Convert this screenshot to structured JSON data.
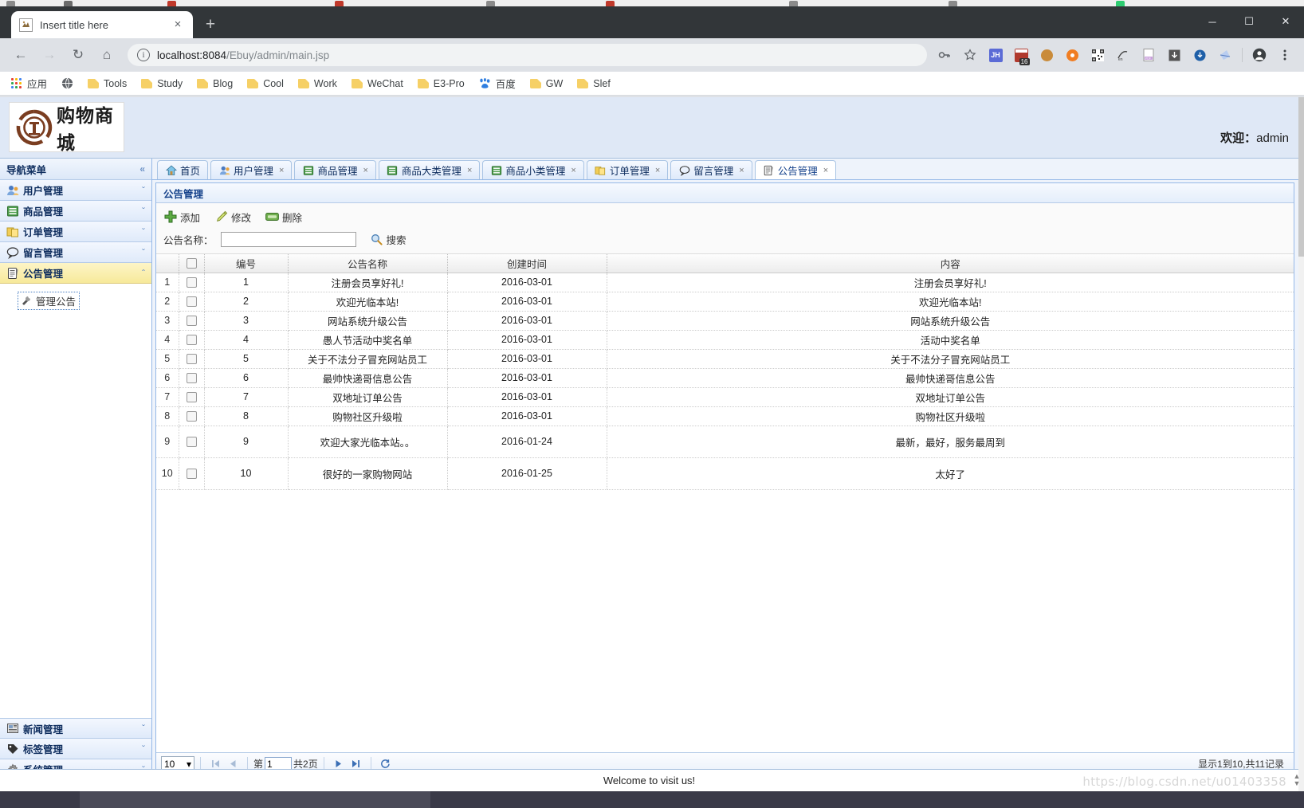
{
  "browser": {
    "tab": {
      "title": "Insert title here",
      "favicon": "page-favicon",
      "close": "×"
    },
    "new_tab": "+",
    "window_controls": {
      "minimize": "─",
      "maximize": "☐",
      "close": "✕"
    },
    "nav": {
      "back": "←",
      "forward": "→",
      "reload": "↻",
      "home": "⌂"
    },
    "omnibox": {
      "info_icon": "i",
      "url_host": "localhost:8084",
      "url_path": "/Ebuy/admin/main.jsp",
      "full_url": "localhost:8084/Ebuy/admin/main.jsp"
    },
    "toolbar_icons": [
      "key-icon",
      "star-icon",
      "jh-extension-icon",
      "calendar-16-icon",
      "monkey-extension-icon",
      "orange-extension-icon",
      "qrcode-extension-icon",
      "translate-extension-icon",
      "pdf-extension-icon",
      "download-extension-icon",
      "circle-download-icon",
      "kite-extension-icon",
      "profile-icon",
      "chrome-menu-icon"
    ],
    "calendar_badge": "16",
    "jh_badge": "JH",
    "bookmarks": {
      "apps_label": "应用",
      "items": [
        {
          "label": "Tools",
          "icon": "folder-icon"
        },
        {
          "label": "Study",
          "icon": "folder-icon"
        },
        {
          "label": "Blog",
          "icon": "folder-icon"
        },
        {
          "label": "Cool",
          "icon": "folder-icon"
        },
        {
          "label": "Work",
          "icon": "folder-icon"
        },
        {
          "label": "WeChat",
          "icon": "folder-icon"
        },
        {
          "label": "E3-Pro",
          "icon": "folder-icon"
        },
        {
          "label": "百度",
          "icon": "baidu-icon"
        },
        {
          "label": "GW",
          "icon": "folder-icon"
        },
        {
          "label": "Slef",
          "icon": "folder-icon"
        }
      ]
    }
  },
  "site": {
    "logo_text": "购物商城",
    "welcome_label": "欢迎：",
    "username": "admin",
    "footer_text": "Welcome to visit us!",
    "watermark": "https://blog.csdn.net/u01403358"
  },
  "sidebar": {
    "title": "导航菜单",
    "collapse_icon": "«",
    "items": [
      {
        "label": "用户管理",
        "icon": "users-icon",
        "expanded": false,
        "chev": "ˇ"
      },
      {
        "label": "商品管理",
        "icon": "goods-icon",
        "expanded": false,
        "chev": "ˇ"
      },
      {
        "label": "订单管理",
        "icon": "order-icon",
        "expanded": false,
        "chev": "ˇ"
      },
      {
        "label": "留言管理",
        "icon": "message-icon",
        "expanded": false,
        "chev": "ˇ"
      },
      {
        "label": "公告管理",
        "icon": "notice-icon",
        "expanded": true,
        "chev": "ˆ"
      }
    ],
    "expanded_children": [
      {
        "label": "管理公告",
        "icon": "tools-icon"
      }
    ],
    "bottom_items": [
      {
        "label": "新闻管理",
        "icon": "news-icon",
        "chev": "ˇ"
      },
      {
        "label": "标签管理",
        "icon": "tag-icon",
        "chev": "ˇ"
      },
      {
        "label": "系统管理",
        "icon": "gear-icon",
        "chev": "ˇ"
      }
    ]
  },
  "tabs": [
    {
      "label": "首页",
      "icon": "home-icon",
      "closable": false,
      "active": false
    },
    {
      "label": "用户管理",
      "icon": "users-icon",
      "closable": true,
      "active": false
    },
    {
      "label": "商品管理",
      "icon": "goods-icon",
      "closable": true,
      "active": false
    },
    {
      "label": "商品大类管理",
      "icon": "goods-icon",
      "closable": true,
      "active": false
    },
    {
      "label": "商品小类管理",
      "icon": "goods-icon",
      "closable": true,
      "active": false
    },
    {
      "label": "订单管理",
      "icon": "order-icon",
      "closable": true,
      "active": false
    },
    {
      "label": "留言管理",
      "icon": "message-icon",
      "closable": true,
      "active": false
    },
    {
      "label": "公告管理",
      "icon": "notice-icon",
      "closable": true,
      "active": true
    }
  ],
  "tab_close_glyph": "×",
  "panel": {
    "title": "公告管理",
    "toolbar": [
      {
        "label": "添加",
        "icon": "add-icon"
      },
      {
        "label": "修改",
        "icon": "edit-icon"
      },
      {
        "label": "删除",
        "icon": "delete-icon"
      }
    ],
    "search": {
      "label": "公告名称：",
      "value": "",
      "placeholder": "",
      "button_label": "搜索",
      "button_icon": "search-icon"
    }
  },
  "table": {
    "columns": [
      "",
      "",
      "编号",
      "公告名称",
      "创建时间",
      "内容"
    ],
    "rows": [
      {
        "n": "1",
        "id": "1",
        "name": "注册会员享好礼!",
        "time": "2016-03-01",
        "content": "注册会员享好礼!",
        "tall": false
      },
      {
        "n": "2",
        "id": "2",
        "name": "欢迎光临本站!",
        "time": "2016-03-01",
        "content": "欢迎光临本站!",
        "tall": false
      },
      {
        "n": "3",
        "id": "3",
        "name": "网站系统升级公告",
        "time": "2016-03-01",
        "content": "网站系统升级公告",
        "tall": false
      },
      {
        "n": "4",
        "id": "4",
        "name": "愚人节活动中奖名单",
        "time": "2016-03-01",
        "content": "活动中奖名单",
        "tall": false
      },
      {
        "n": "5",
        "id": "5",
        "name": "关于不法分子冒充网站员工",
        "time": "2016-03-01",
        "content": "关于不法分子冒充网站员工",
        "tall": false
      },
      {
        "n": "6",
        "id": "6",
        "name": "最帅快递哥信息公告",
        "time": "2016-03-01",
        "content": "最帅快递哥信息公告",
        "tall": false
      },
      {
        "n": "7",
        "id": "7",
        "name": "双地址订单公告",
        "time": "2016-03-01",
        "content": "双地址订单公告",
        "tall": false
      },
      {
        "n": "8",
        "id": "8",
        "name": "购物社区升级啦",
        "time": "2016-03-01",
        "content": "购物社区升级啦",
        "tall": false
      },
      {
        "n": "9",
        "id": "9",
        "name": "欢迎大家光临本站。。",
        "time": "2016-01-24",
        "content": "最新，最好，服务最周到",
        "tall": true
      },
      {
        "n": "10",
        "id": "10",
        "name": "很好的一家购物网站",
        "time": "2016-01-25",
        "content": "太好了",
        "tall": true
      }
    ]
  },
  "pager": {
    "page_size": "10",
    "page_size_caret": "▾",
    "first_icon": "⏮",
    "prev_icon": "◀",
    "page_label_prefix": "第",
    "page_value": "1",
    "page_label_suffix": "共2页",
    "next_icon": "▶",
    "last_icon": "⏭",
    "refresh_icon": "↻",
    "status": "显示1到10,共11记录"
  }
}
